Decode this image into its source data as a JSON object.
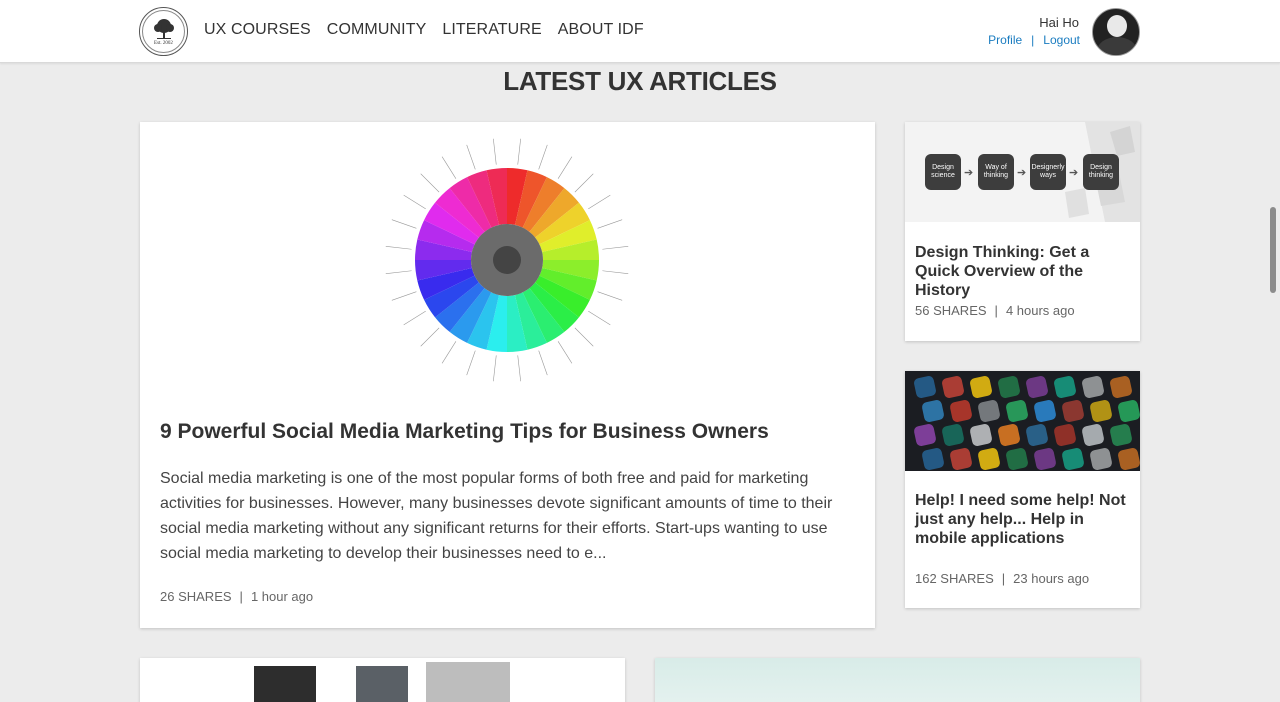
{
  "header": {
    "logo_est": "Est. 2002",
    "nav": [
      "UX COURSES",
      "COMMUNITY",
      "LITERATURE",
      "ABOUT IDF"
    ],
    "user": {
      "name": "Hai Ho",
      "profile": "Profile",
      "separator": "|",
      "logout": "Logout"
    }
  },
  "section_title": "LATEST UX ARTICLES",
  "feature": {
    "title": "9 Powerful Social Media Marketing Tips for Business Owners",
    "excerpt": "Social media marketing is one of the most popular forms of both free and paid for marketing activities for businesses. However, many businesses devote significant amounts of time to their social media marketing without any significant returns for their efforts. Start-ups wanting to use social media marketing to develop their businesses need to e...",
    "shares": "26 SHARES",
    "time": "1 hour ago"
  },
  "side_articles": [
    {
      "title": "Design Thinking: Get a Quick Overview of the History",
      "shares": "56 SHARES",
      "time": "4 hours ago",
      "diagram_steps": [
        "Design science",
        "Way of thinking",
        "Designerly ways",
        "Design thinking"
      ]
    },
    {
      "title": "Help! I need some help! Not just any help... Help in mobile applications",
      "shares": "162 SHARES",
      "time": "23 hours ago"
    }
  ],
  "meta_separator": "|"
}
